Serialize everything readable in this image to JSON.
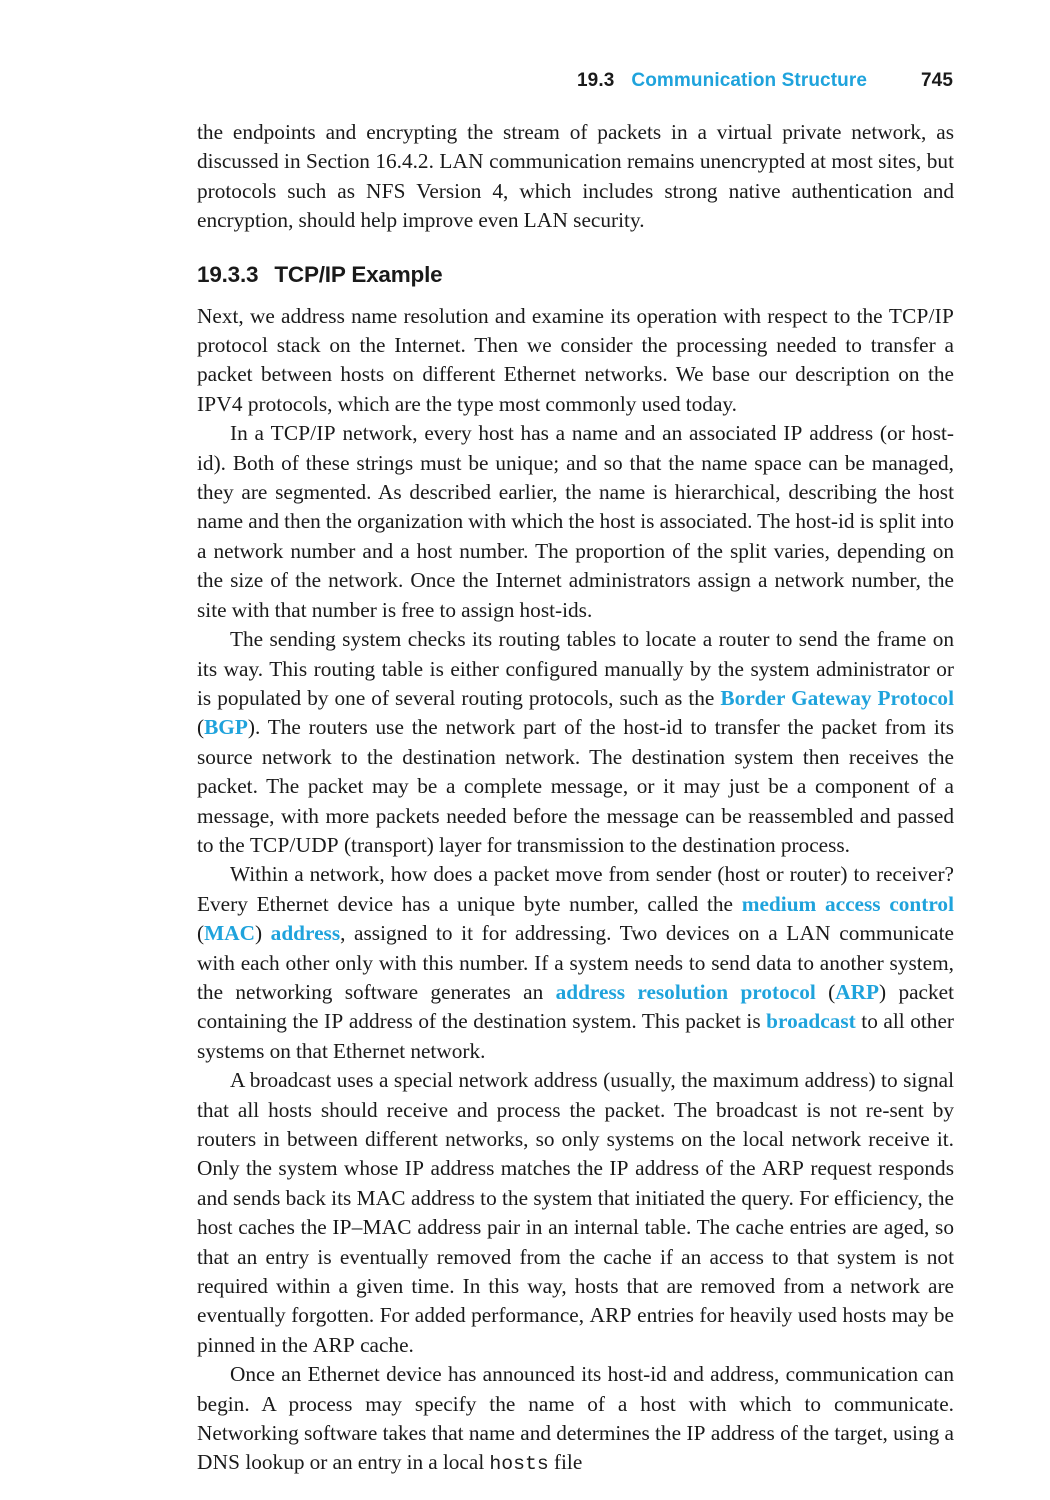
{
  "page": {
    "folio": "745",
    "accent_color": "#1FA3DC",
    "text_color": "#1a1a1a",
    "background_color": "#ffffff"
  },
  "running_head": {
    "section_number": "19.3",
    "section_title": "Communication Structure",
    "page_number": "745"
  },
  "section": {
    "number": "19.3.3",
    "title": "TCP/IP Example"
  },
  "paragraphs": {
    "p0": {
      "runs": [
        {
          "text": "the endpoints and encrypting the stream of packets in a virtual private network, as discussed in Section 16.4.2. ",
          "style": "normal"
        },
        {
          "text": "LAN",
          "style": "smallcaps"
        },
        {
          "text": " communication remains unencrypted at most sites, but protocols such as ",
          "style": "normal"
        },
        {
          "text": "NFS",
          "style": "smallcaps"
        },
        {
          "text": " Version 4, which includes strong native authentication and encryption, should help improve even ",
          "style": "normal"
        },
        {
          "text": "LAN",
          "style": "smallcaps"
        },
        {
          "text": " security.",
          "style": "normal"
        }
      ]
    },
    "p1": {
      "runs": [
        {
          "text": "Next, we address name resolution and examine its operation with respect to the ",
          "style": "normal"
        },
        {
          "text": "TCP/IP",
          "style": "smallcaps"
        },
        {
          "text": " protocol stack on the Internet. Then we consider the processing needed to transfer a packet between hosts on different Ethernet networks. We base our description on the ",
          "style": "normal"
        },
        {
          "text": "IPV4",
          "style": "smallcaps"
        },
        {
          "text": " protocols, which are the type most commonly used today.",
          "style": "normal"
        }
      ]
    },
    "p2": {
      "runs": [
        {
          "text": "In a ",
          "style": "normal"
        },
        {
          "text": "TCP/IP",
          "style": "smallcaps"
        },
        {
          "text": " network, every host has a name and an associated ",
          "style": "normal"
        },
        {
          "text": "IP",
          "style": "smallcaps"
        },
        {
          "text": " address (or host-id). Both of these strings must be unique; and so that the name space can be managed, they are segmented. As described earlier, the name is hierarchical, describing the host name and then the organization with which the host is associated. The host-id is split into a network number and a host number. The proportion of the split varies, depending on the size of the network. Once the Internet administrators assign a network number, the site with that number is free to assign host-ids.",
          "style": "normal"
        }
      ]
    },
    "p3": {
      "runs": [
        {
          "text": "The sending system checks its routing tables to locate a router to send the frame on its way. This routing table is either configured manually by the system administrator or is populated by one of several routing protocols, such as the ",
          "style": "normal"
        },
        {
          "text": "Border Gateway Protocol",
          "style": "term"
        },
        {
          "text": " (",
          "style": "normal"
        },
        {
          "text": "BGP",
          "style": "term-smallcaps"
        },
        {
          "text": "). The routers use the network part of the host-id to transfer the packet from its source network to the destination network. The destination system then receives the packet. The packet may be a complete message, or it may just be a component of a message, with more packets needed before the message can be reassembled and passed to the ",
          "style": "normal"
        },
        {
          "text": "TCP/UDP",
          "style": "smallcaps"
        },
        {
          "text": " (transport) layer for transmission to the destination process.",
          "style": "normal"
        }
      ]
    },
    "p4": {
      "runs": [
        {
          "text": "Within a network, how does a packet move from sender (host or router) to receiver? Every Ethernet device has a unique byte number, called the ",
          "style": "normal"
        },
        {
          "text": "medium access control",
          "style": "term"
        },
        {
          "text": " (",
          "style": "normal"
        },
        {
          "text": "MAC",
          "style": "term-smallcaps"
        },
        {
          "text": ") ",
          "style": "normal"
        },
        {
          "text": "address",
          "style": "term"
        },
        {
          "text": ", assigned to it for addressing. Two devices on a ",
          "style": "normal"
        },
        {
          "text": "LAN",
          "style": "smallcaps"
        },
        {
          "text": " communicate with each other only with this number. If a system needs to send data to another system, the networking software generates an ",
          "style": "normal"
        },
        {
          "text": "address resolution protocol",
          "style": "term"
        },
        {
          "text": " (",
          "style": "normal"
        },
        {
          "text": "ARP",
          "style": "term-smallcaps"
        },
        {
          "text": ") packet containing the ",
          "style": "normal"
        },
        {
          "text": "IP",
          "style": "smallcaps"
        },
        {
          "text": " address of the destination system. This packet is ",
          "style": "normal"
        },
        {
          "text": "broadcast",
          "style": "term"
        },
        {
          "text": " to all other systems on that Ethernet network.",
          "style": "normal"
        }
      ]
    },
    "p5": {
      "runs": [
        {
          "text": "A broadcast uses a special network address (usually, the maximum address) to signal that all hosts should receive and process the packet. The broadcast is not re-sent by routers in between different networks, so only systems on the local network receive it. Only the system whose ",
          "style": "normal"
        },
        {
          "text": "IP",
          "style": "smallcaps"
        },
        {
          "text": " address matches the ",
          "style": "normal"
        },
        {
          "text": "IP",
          "style": "smallcaps"
        },
        {
          "text": " address of the ",
          "style": "normal"
        },
        {
          "text": "ARP",
          "style": "smallcaps"
        },
        {
          "text": " request responds and sends back its ",
          "style": "normal"
        },
        {
          "text": "MAC",
          "style": "smallcaps"
        },
        {
          "text": " address to the system that initiated the query. For efficiency, the host caches the ",
          "style": "normal"
        },
        {
          "text": "IP–MAC",
          "style": "smallcaps"
        },
        {
          "text": " address pair in an internal table. The cache entries are aged, so that an entry is eventually removed from the cache if an access to that system is not required within a given time. In this way, hosts that are removed from a network are eventually forgotten. For added performance, ",
          "style": "normal"
        },
        {
          "text": "ARP",
          "style": "smallcaps"
        },
        {
          "text": " entries for heavily used hosts may be pinned in the ",
          "style": "normal"
        },
        {
          "text": "ARP",
          "style": "smallcaps"
        },
        {
          "text": " cache.",
          "style": "normal"
        }
      ]
    },
    "p6": {
      "runs": [
        {
          "text": "Once an Ethernet device has announced its host-id and address, communication can begin. A process may specify the name of a host with which to communicate. Networking software takes that name and determines the ",
          "style": "normal"
        },
        {
          "text": "IP",
          "style": "smallcaps"
        },
        {
          "text": " address of the target, using a ",
          "style": "normal"
        },
        {
          "text": "DNS",
          "style": "smallcaps"
        },
        {
          "text": " lookup or an entry in a local ",
          "style": "normal"
        },
        {
          "text": "hosts",
          "style": "mono"
        },
        {
          "text": " file",
          "style": "normal"
        }
      ]
    }
  }
}
